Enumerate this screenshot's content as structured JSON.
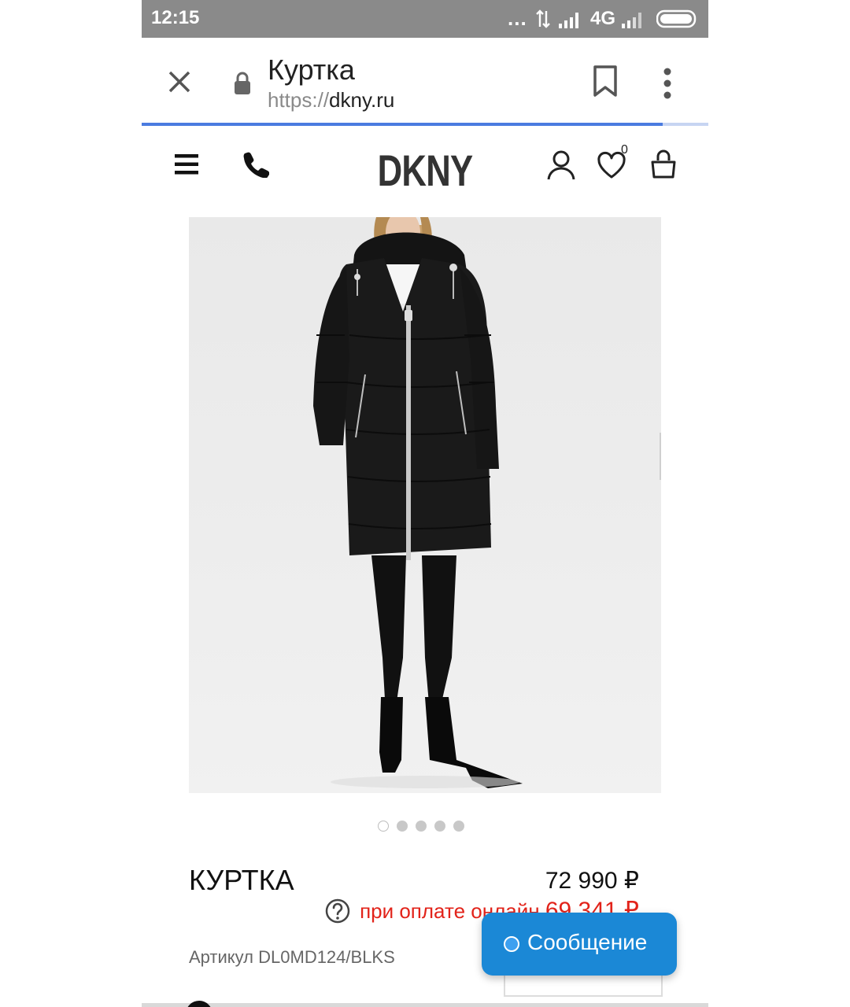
{
  "status_bar": {
    "time": "12:15",
    "network": "4G",
    "dots": "..."
  },
  "browser": {
    "tab_title": "Куртка",
    "url_scheme": "https://",
    "url_host": "dkny.ru",
    "load_progress": 0.92
  },
  "site_header": {
    "logo": "DKNY",
    "wishlist_count": "0"
  },
  "product": {
    "image_alt": "",
    "carousel_total": 5,
    "carousel_active": 1,
    "name": "КУРТКА",
    "price": "72 990 ₽",
    "online_prefix": "при оплате онлайн",
    "online_price": "69 341 ₽",
    "article": "Артикул DL0MD124/BLKS"
  },
  "chat": {
    "label": "Сообщение"
  },
  "colors": {
    "accent": "#1b88d6",
    "sale": "#e2231a",
    "progress": "#4a7be0"
  }
}
